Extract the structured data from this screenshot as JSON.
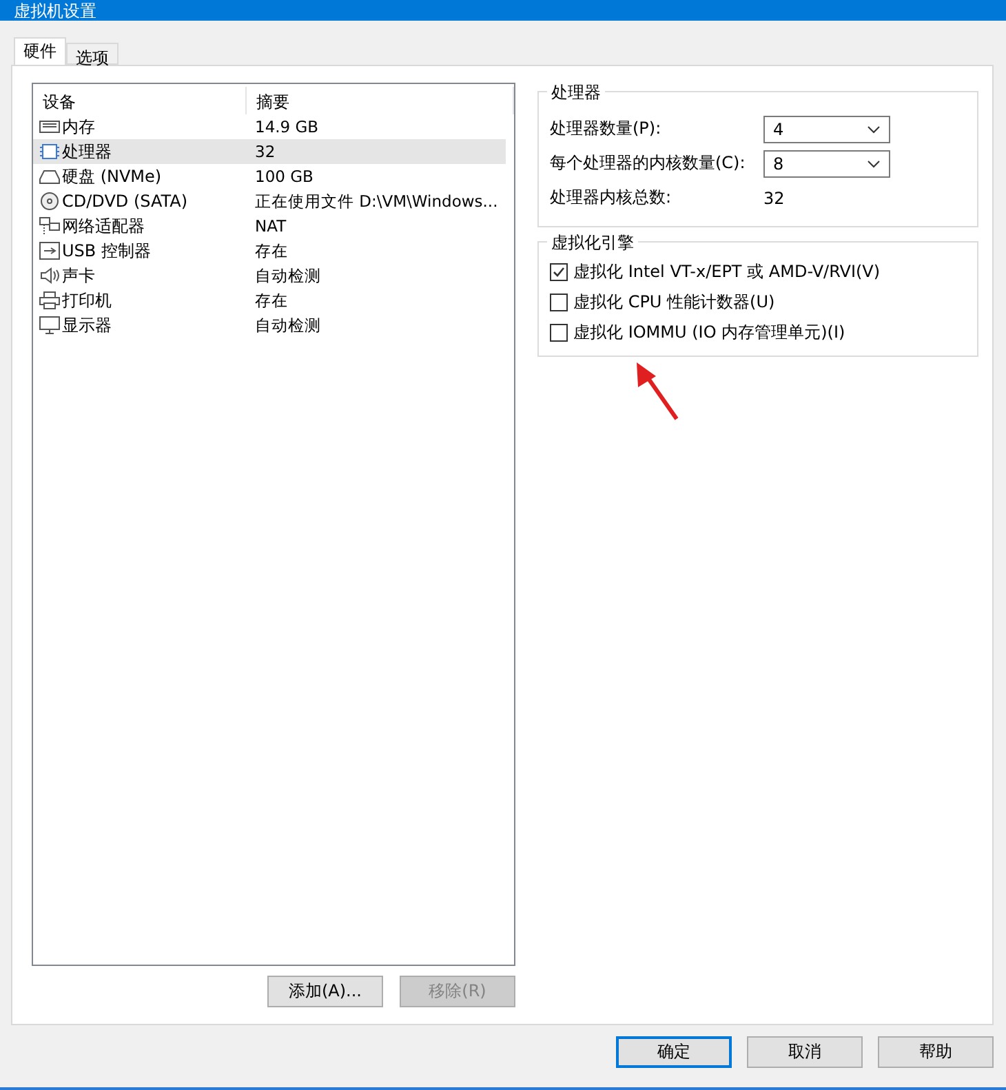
{
  "window": {
    "title": "虚拟机设置"
  },
  "tabs": [
    {
      "label": "硬件",
      "selected": true
    },
    {
      "label": "选项",
      "selected": false
    }
  ],
  "device_list": {
    "columns": [
      "设备",
      "摘要"
    ],
    "rows": [
      {
        "kind": "memory",
        "device": "内存",
        "summary": "14.9 GB",
        "selected": false
      },
      {
        "kind": "cpu",
        "device": "处理器",
        "summary": "32",
        "selected": true
      },
      {
        "kind": "disk",
        "device": "硬盘 (NVMe)",
        "summary": "100 GB",
        "selected": false
      },
      {
        "kind": "cd",
        "device": "CD/DVD (SATA)",
        "summary": "正在使用文件 D:\\VM\\Windows...",
        "selected": false
      },
      {
        "kind": "network",
        "device": "网络适配器",
        "summary": "NAT",
        "selected": false
      },
      {
        "kind": "usb",
        "device": "USB 控制器",
        "summary": "存在",
        "selected": false
      },
      {
        "kind": "sound",
        "device": "声卡",
        "summary": "自动检测",
        "selected": false
      },
      {
        "kind": "printer",
        "device": "打印机",
        "summary": "存在",
        "selected": false
      },
      {
        "kind": "display",
        "device": "显示器",
        "summary": "自动检测",
        "selected": false
      }
    ]
  },
  "list_buttons": [
    {
      "label": "添加(A)...",
      "disabled": false
    },
    {
      "label": "移除(R)",
      "disabled": true
    }
  ],
  "processor_group": {
    "title": "处理器",
    "fields": [
      {
        "label": "处理器数量(P):",
        "value": "4"
      },
      {
        "label": "每个处理器的内核数量(C):",
        "value": "8"
      }
    ],
    "total_label": "处理器内核总数:",
    "total_value": "32"
  },
  "virtualization_group": {
    "title": "虚拟化引擎",
    "options": [
      {
        "label": "虚拟化 Intel VT-x/EPT 或 AMD-V/RVI(V)",
        "checked": true
      },
      {
        "label": "虚拟化 CPU 性能计数器(U)",
        "checked": false
      },
      {
        "label": "虚拟化 IOMMU (IO 内存管理单元)(I)",
        "checked": false
      }
    ]
  },
  "dialog_buttons": [
    {
      "label": "确定",
      "default": true
    },
    {
      "label": "取消",
      "default": false
    },
    {
      "label": "帮助",
      "default": false
    }
  ]
}
